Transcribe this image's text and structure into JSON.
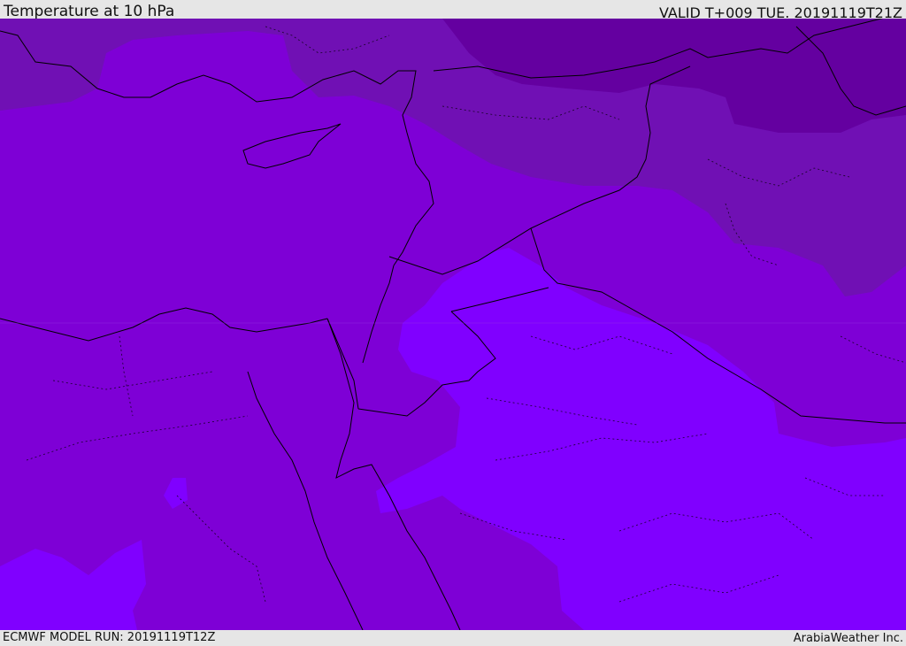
{
  "header": {
    "title": "Temperature at 10 hPa",
    "valid": "VALID T+009 TUE. 20191119T21Z"
  },
  "footer": {
    "model_run": "ECMWF MODEL RUN: 20191119T12Z",
    "credit": "ArabiaWeather Inc."
  },
  "map": {
    "field": "temperature",
    "level": "10 hPa",
    "colors": {
      "darkest": "#6400a0",
      "darker": "#7010b4",
      "mid": "#7e00d6",
      "light": "#8000ff",
      "border": "#000000"
    }
  }
}
